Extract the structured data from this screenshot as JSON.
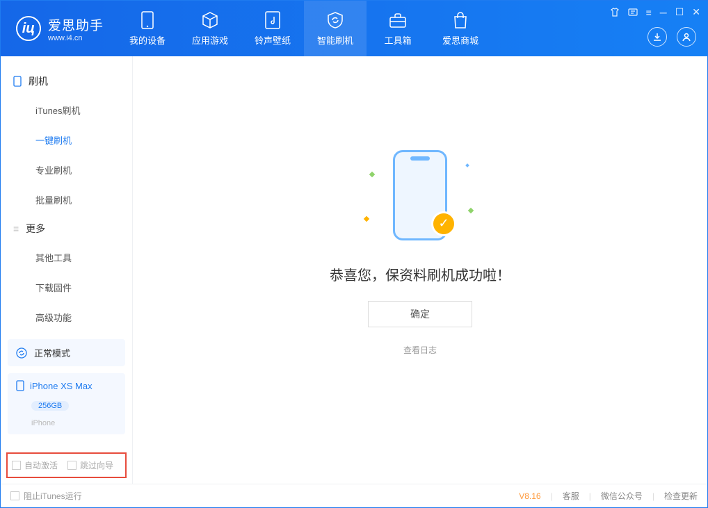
{
  "app": {
    "name": "爱思助手",
    "url": "www.i4.cn"
  },
  "nav": {
    "items": [
      {
        "label": "我的设备"
      },
      {
        "label": "应用游戏"
      },
      {
        "label": "铃声壁纸"
      },
      {
        "label": "智能刷机"
      },
      {
        "label": "工具箱"
      },
      {
        "label": "爱思商城"
      }
    ],
    "active_index": 3
  },
  "sidebar": {
    "groups": [
      {
        "title": "刷机",
        "items": [
          "iTunes刷机",
          "一键刷机",
          "专业刷机",
          "批量刷机"
        ],
        "active_index": 1
      },
      {
        "title": "更多",
        "items": [
          "其他工具",
          "下载固件",
          "高级功能"
        ],
        "active_index": -1
      }
    ]
  },
  "device": {
    "mode_label": "正常模式",
    "name": "iPhone XS Max",
    "capacity": "256GB",
    "type": "iPhone"
  },
  "options": {
    "auto_activate": "自动激活",
    "skip_guide": "跳过向导"
  },
  "main": {
    "success_text": "恭喜您，保资料刷机成功啦！",
    "ok_button": "确定",
    "view_log": "查看日志"
  },
  "footer": {
    "block_itunes": "阻止iTunes运行",
    "version": "V8.16",
    "links": [
      "客服",
      "微信公众号",
      "检查更新"
    ]
  }
}
